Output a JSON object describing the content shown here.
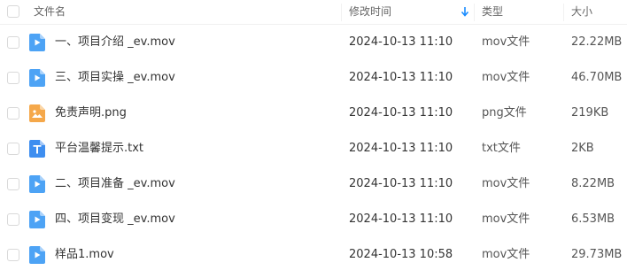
{
  "header": {
    "name": "文件名",
    "modified": "修改时间",
    "type": "类型",
    "size": "大小"
  },
  "colors": {
    "video_icon": "#4da3f5",
    "image_icon": "#f5a84a",
    "text_icon": "#3e8ef0",
    "sort_arrow": "#1a8cff"
  },
  "files": [
    {
      "name": "一、项目介绍 _ev.mov",
      "modified": "2024-10-13 11:10",
      "type": "mov文件",
      "size": "22.22MB",
      "icon": "video-file-icon"
    },
    {
      "name": "三、项目实操 _ev.mov",
      "modified": "2024-10-13 11:10",
      "type": "mov文件",
      "size": "46.70MB",
      "icon": "video-file-icon"
    },
    {
      "name": "免责声明.png",
      "modified": "2024-10-13 11:10",
      "type": "png文件",
      "size": "219KB",
      "icon": "image-file-icon"
    },
    {
      "name": "平台温馨提示.txt",
      "modified": "2024-10-13 11:10",
      "type": "txt文件",
      "size": "2KB",
      "icon": "text-file-icon"
    },
    {
      "name": "二、项目准备 _ev.mov",
      "modified": "2024-10-13 11:10",
      "type": "mov文件",
      "size": "8.22MB",
      "icon": "video-file-icon"
    },
    {
      "name": "四、项目变现 _ev.mov",
      "modified": "2024-10-13 11:10",
      "type": "mov文件",
      "size": "6.53MB",
      "icon": "video-file-icon"
    },
    {
      "name": "样品1.mov",
      "modified": "2024-10-13 10:58",
      "type": "mov文件",
      "size": "29.73MB",
      "icon": "video-file-icon"
    }
  ]
}
